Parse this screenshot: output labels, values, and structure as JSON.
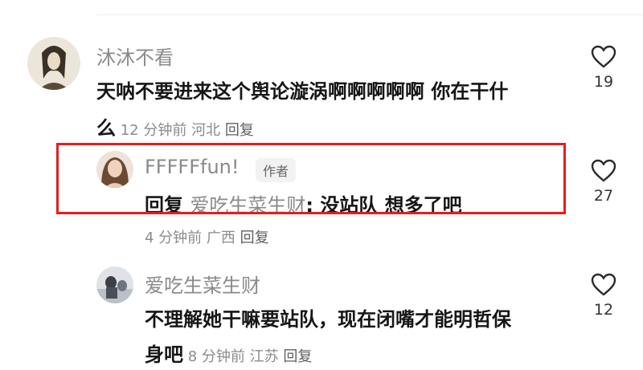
{
  "comments": [
    {
      "username": "沐沐不看",
      "text_line1": "天呐不要进来这个舆论漩涡啊啊啊啊啊   你在干什",
      "text_line2": "么",
      "time": "12 分钟前",
      "location": "河北",
      "reply_label": "回复",
      "likes": "19"
    },
    {
      "username": "FFFFFfun!",
      "author_tag": "作者",
      "reply_prefix": "回复",
      "mention": "爱吃生菜生财",
      "text": ": 没站队 想多了吧",
      "time": "4 分钟前",
      "location": "广西",
      "reply_label": "回复",
      "likes": "27"
    },
    {
      "username": "爱吃生菜生财",
      "text_line1": "不理解她干嘛要站队，现在闭嘴才能明哲保",
      "text_line2": "身吧",
      "time": "8 分钟前",
      "location": "江苏",
      "reply_label": "回复",
      "likes": "12"
    }
  ],
  "colors": {
    "highlight": "#e51d1d",
    "username": "#8a8a8a",
    "meta": "#8b8b8b"
  },
  "icons": {
    "like": "heart-outline-icon"
  }
}
